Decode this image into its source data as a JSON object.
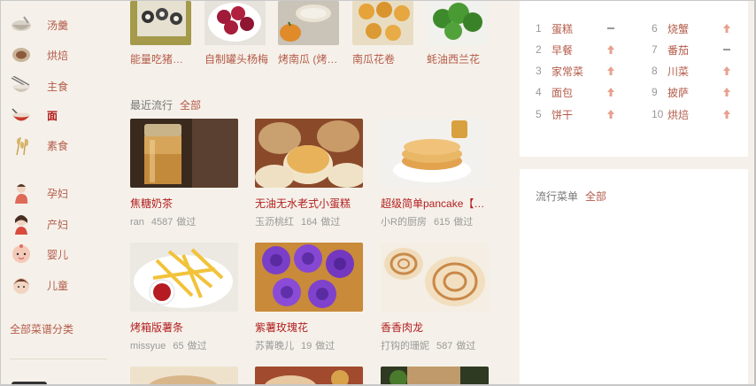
{
  "sidebar": {
    "categories": [
      {
        "label": "汤羹",
        "icon": "soup-bowl-icon"
      },
      {
        "label": "烘焙",
        "icon": "baking-pie-icon"
      },
      {
        "label": "主食",
        "icon": "rice-bowl-chopsticks-icon"
      },
      {
        "label": "面",
        "icon": "noodle-bowl-icon"
      },
      {
        "label": "素食",
        "icon": "wheat-icon"
      },
      {
        "label": "孕妇",
        "icon": "pregnant-woman-icon"
      },
      {
        "label": "产妇",
        "icon": "mother-icon"
      },
      {
        "label": "婴儿",
        "icon": "baby-icon"
      },
      {
        "label": "儿童",
        "icon": "child-icon"
      }
    ],
    "all_categories": "全部菜谱分类"
  },
  "top_row": {
    "items": [
      {
        "label": "能量吃猪…"
      },
      {
        "label": "自制罐头杨梅"
      },
      {
        "label": "烤南瓜 (烤…"
      },
      {
        "label": "南瓜花卷"
      },
      {
        "label": "蚝油西兰花"
      }
    ]
  },
  "recent": {
    "title": "最近流行",
    "all_link": "全部",
    "cards": [
      {
        "name": "焦糖奶茶",
        "author": "ran",
        "count": "4587",
        "cook_label": "做过"
      },
      {
        "name": "无油无水老式小蛋糕",
        "author": "玉沥桃红",
        "count": "164",
        "cook_label": "做过"
      },
      {
        "name": "超级简单pancake【…",
        "author": "小R的厨房",
        "count": "615",
        "cook_label": "做过"
      },
      {
        "name": "烤箱版薯条",
        "author": "missyue",
        "count": "65",
        "cook_label": "做过"
      },
      {
        "name": "紫薯玫瑰花",
        "author": "苏菁晚儿",
        "count": "19",
        "cook_label": "做过"
      },
      {
        "name": "香香肉龙",
        "author": "打钩的珊妮",
        "count": "587",
        "cook_label": "做过"
      }
    ]
  },
  "ranking": {
    "items": [
      {
        "num": "1",
        "kw": "蛋糕",
        "trend": "flat"
      },
      {
        "num": "2",
        "kw": "早餐",
        "trend": "up"
      },
      {
        "num": "3",
        "kw": "家常菜",
        "trend": "up"
      },
      {
        "num": "4",
        "kw": "面包",
        "trend": "up"
      },
      {
        "num": "5",
        "kw": "饼干",
        "trend": "up"
      },
      {
        "num": "6",
        "kw": "烧蟹",
        "trend": "up"
      },
      {
        "num": "7",
        "kw": "番茄",
        "trend": "flat"
      },
      {
        "num": "8",
        "kw": "川菜",
        "trend": "up"
      },
      {
        "num": "9",
        "kw": "披萨",
        "trend": "up"
      },
      {
        "num": "10",
        "kw": "烘焙",
        "trend": "up"
      }
    ]
  },
  "trending_menus": {
    "title": "流行菜单",
    "all_link": "全部"
  },
  "colors": {
    "accent": "#b21e1e",
    "link": "#b45b49",
    "trend_up": "#e8a08f",
    "page_bg": "#f5f1ea"
  }
}
